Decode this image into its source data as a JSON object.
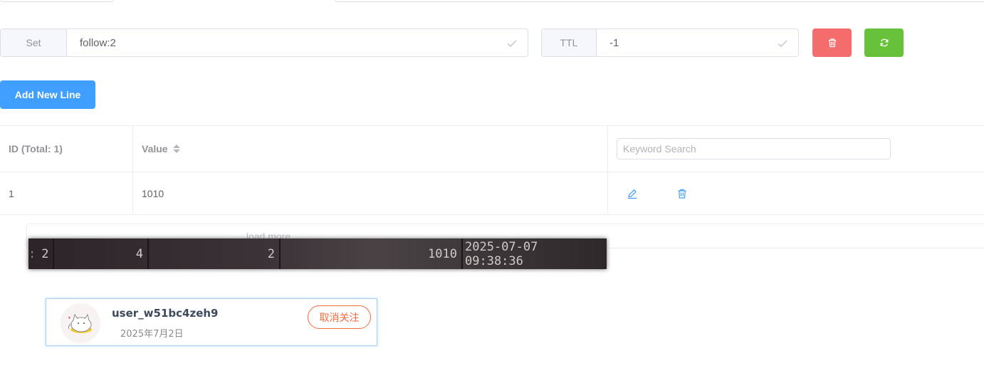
{
  "key_bar": {
    "type_label": "Set",
    "key_name": "follow:2",
    "ttl_label": "TTL",
    "ttl_value": "-1",
    "delete_icon": "trash-icon",
    "refresh_icon": "refresh-icon"
  },
  "add_button_label": "Add New Line",
  "table": {
    "headers": {
      "id": "ID (Total: 1)",
      "value": "Value",
      "search_placeholder": "Keyword Search"
    },
    "rows": [
      {
        "id": "1",
        "value": "1010"
      }
    ]
  },
  "load_more_label": "load more",
  "terminal_row": {
    "cells": [
      "2",
      "4",
      "2",
      "1010",
      "2025-07-07 09:38:36"
    ]
  },
  "follow_card": {
    "username": "user_w51bc4zeh9",
    "date": "2025年7月2日",
    "unfollow_label": "取消关注"
  },
  "colors": {
    "primary": "#409eff",
    "danger": "#f56c6c",
    "success": "#67c23a",
    "unfollow": "#f26b3a"
  }
}
